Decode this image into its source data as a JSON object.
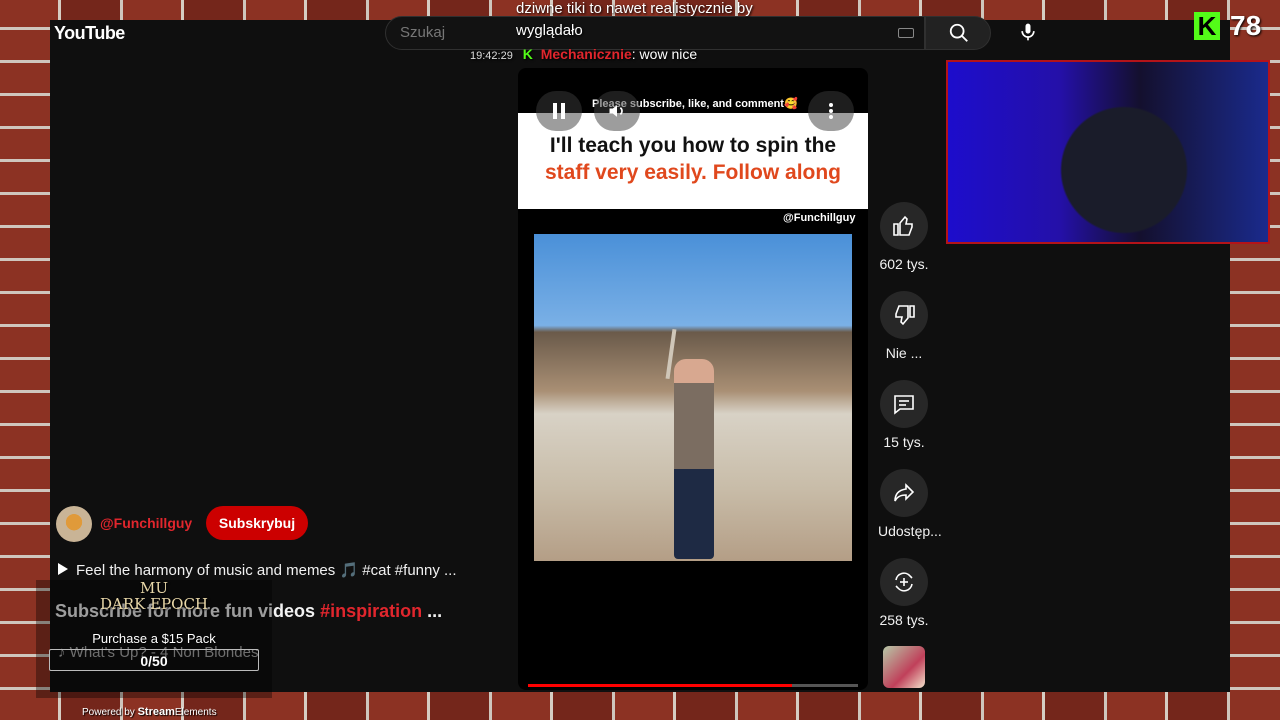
{
  "youtube": {
    "logo": "YouTube",
    "search_placeholder": "Szukaj"
  },
  "stream_overlay": {
    "top_message_line1": "dziwne tiki to nawet realistycznie by",
    "top_message_line2": "wyglądało",
    "chat": {
      "time": "19:42:29",
      "badge": "K",
      "user": "Mechanicznie",
      "message": ": wow nice"
    },
    "kick_viewers": "78",
    "kick_logo": "K"
  },
  "short": {
    "banner": "Please subscribe, like, and comment🥰",
    "caption_line1": "I'll teach you how to spin the",
    "caption_line2": "staff very easily. Follow along",
    "watermark": "@Funchillguy",
    "progress_fraction": 0.8
  },
  "actions": [
    {
      "icon": "thumbs-up-icon",
      "label": "602 tys."
    },
    {
      "icon": "thumbs-down-icon",
      "label": "Nie ..."
    },
    {
      "icon": "comment-icon",
      "label": "15 tys."
    },
    {
      "icon": "share-icon",
      "label": "Udostęp..."
    },
    {
      "icon": "remix-icon",
      "label": "258 tys."
    }
  ],
  "channel": {
    "name": "@Funchillguy",
    "subscribe_label": "Subskrybuj"
  },
  "description": {
    "line": "Feel the harmony of music and memes 🎵 #cat #funny ...",
    "title_prefix": "Subscribe for more fun videos",
    "title_hashtag": "#inspiration",
    "title_suffix": "...",
    "music": "♪ What's Up? - 4 Non Blondes"
  },
  "widget": {
    "logo_line1": "MU",
    "logo_line2": "DARK EPOCH",
    "title": "Purchase a $15 Pack",
    "count": "0/50",
    "footer_prefix": "Powered by",
    "footer_brand_1": "Stream",
    "footer_brand_2": "Elements"
  },
  "colors": {
    "kick_green": "#53fc18",
    "yt_red": "#cc0000",
    "hashtag_red": "#e1262d",
    "caption_orange": "#e0481d"
  }
}
